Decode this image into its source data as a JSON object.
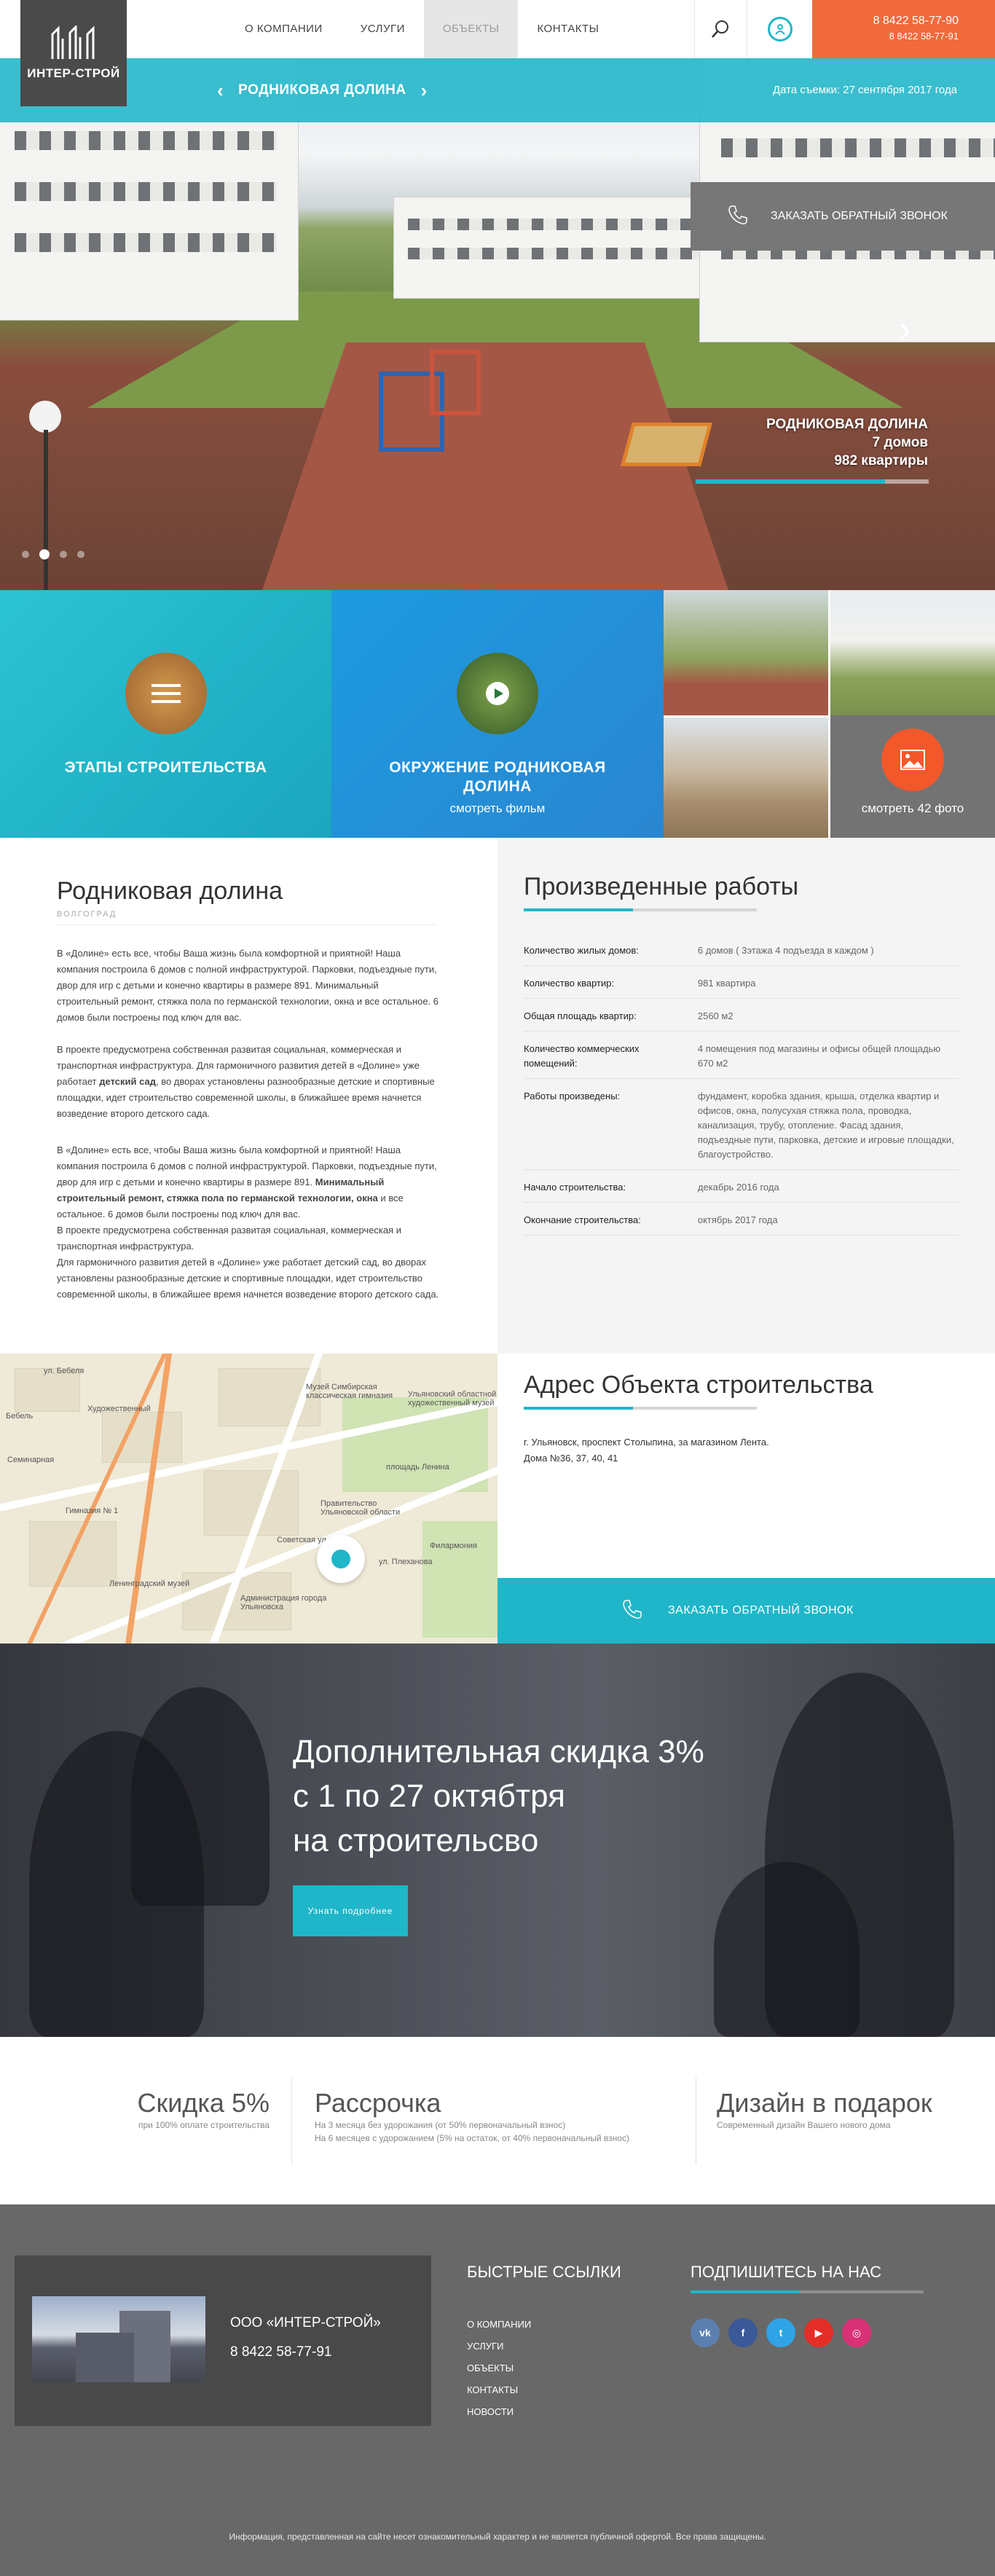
{
  "header": {
    "logo_text": "ИНТЕР-СТРОЙ",
    "nav": [
      "О КОМПАНИИ",
      "УСЛУГИ",
      "ОБЪЕКТЫ",
      "КОНТАКТЫ"
    ],
    "phone_1": "8 8422 58-77-90",
    "phone_2": "8 8422 58-77-91",
    "accent": "#1fb6c9",
    "phone_bg": "#f26a3b"
  },
  "hero": {
    "object_name": "РОДНИКОВАЯ ДОЛИНА",
    "shoot_date": "Дата съемки: 27 сентября 2017 года",
    "caption_title": "РОДНИКОВАЯ ДОЛИНА",
    "caption_houses": "7 домов",
    "caption_flats": "982 квартиры",
    "slide_count": 4,
    "active_slide": 2
  },
  "tiles": {
    "stages": "ЭТАПЫ СТРОИТЕЛЬСТВА",
    "env_line1": "ОКРУЖЕНИЕ РОДНИКОВАЯ",
    "env_line2": "ДОЛИНА",
    "env_sub": "смотреть фильм",
    "photos": "смотреть 42 фото"
  },
  "about": {
    "title": "Родниковая долина",
    "city": "ВОЛГОГРАД",
    "p1": "В «Долине» есть все, чтобы Ваша жизнь была комфортной и приятной! Наша компания построила 6 домов с полной инфраструктурой. Парковки, подъездные пути, двор для игр с детьми и конечно квартиры в размере 891. Минимальный строительный ремонт, стяжка пола по германской технологии, окна и все остальное. 6 домов были построены под ключ для вас.",
    "p2a": "В проекте предусмотрена собственная развитая социальная, коммерческая и транспортная инфраструктура. Для гармоничного развития детей в «Долине» уже работает ",
    "p2b": "детский сад",
    "p2c": ", во дворах установлены разнообразные детские и спортивные площадки, идет строительство современной школы, в ближайшее время начнется возведение второго детского сада.",
    "p3a": "В «Долине» есть все, чтобы Ваша жизнь была комфортной и приятной! Наша компания построила 6 домов с полной инфраструктурой. Парковки, подъездные пути, двор для игр с детьми и конечно квартиры в разме­ре 891. ",
    "p3b": "Минимальный строительный ремонт, стяжка пола по германской тех­нологии, окна",
    "p3c": " и все остальное. 6 домов были построены под ключ для вас.",
    "p3d": "В проекте предусмотрена собственная развитая социальная, коммерческая и транспортная инфраструктура.",
    "p3e": "Для гармоничного развития детей в «Долине» уже работает детский сад, во дворах установлены разнообразные детские и спортивные площадки, идет строительство современной школы, в ближайшее время начнется возведение второго детского сада."
  },
  "works": {
    "title": "Произведенные работы",
    "rows": [
      {
        "k": "Количество  жилых домов:",
        "v": "6 домов ( 3этажа 4 подъезда в каждом )"
      },
      {
        "k": "Количество квартир:",
        "v": "981 квартира"
      },
      {
        "k": "Общая площадь квартир:",
        "v": "2560 м2"
      },
      {
        "k": "Количество коммерческих помещений:",
        "v": "4 помещения под магазины и офисы общей площадью 670 м2"
      },
      {
        "k": "Работы произведены:",
        "v": "фундамент, коробка здания, крыша, отделка квартир и офисов, окна, полусухая стяжка пола, проводка, канализация, трубу, отопление. Фасад здания, подъездные пути, парковка, детские и игровые площадки, благоустройство."
      },
      {
        "k": "Начало строительства:",
        "v": "декабрь 2016 года"
      },
      {
        "k": "Окончание строительства:",
        "v": "октябрь 2017 года"
      }
    ]
  },
  "map": {
    "labels": [
      "ул. Бебеля",
      "Художественный",
      "Музей Симбирская классическая гимназия",
      "Ульяновский областной художественный музей",
      "площадь Ленина",
      "Правительство Ульяновской области",
      "Администрация города Ульяновска",
      "Гимназия № 1",
      "Филармония",
      "Ленинградский музей",
      "Советская ул.",
      "ул. Плеханова",
      "Семинарная",
      "Бебель"
    ]
  },
  "address": {
    "title": "Адрес Объекта строительства",
    "line1": "г. Ульяновск, проспект Столыпина, за магазином Лента.",
    "line2": "Дома №36, 37, 40, 41",
    "callback": "ЗАКАЗАТЬ ОБРАТНЫЙ ЗВОНОК"
  },
  "promo": {
    "line1": "Дополнительная скидка 3%",
    "line2": "с 1 по 27 октябтря",
    "line3": "на строительсво",
    "button": "Узнать подробнее"
  },
  "benefits": [
    {
      "title": "Скидка 5%",
      "sub1": "при 100% оплате строительства",
      "sub2": ""
    },
    {
      "title": "Рассрочка",
      "sub1": "На 3 месяца без удорожания (от 50% первоначальный взнос)",
      "sub2": "На 6 месяцев с удорожанием (5% на остаток, от 40% первоначальный взнос)"
    },
    {
      "title": "Дизайн в подарок",
      "sub1": "Современный дизайн Вашего нового дома",
      "sub2": ""
    }
  ],
  "footer": {
    "company": "ООО «ИНТЕР-СТРОЙ»",
    "phone": "8 8422 58-77-91",
    "links_title": "БЫСТРЫЕ ССЫЛКИ",
    "links": [
      "О КОМПАНИИ",
      "УСЛУГИ",
      "ОБЪЕКТЫ",
      "КОНТАКТЫ",
      "НОВОСТИ"
    ],
    "subscribe_title": "ПОДПИШИТЕСЬ НА НАС",
    "socials": [
      {
        "name": "vk-icon",
        "glyph": "vk",
        "color": "#5b7fb0"
      },
      {
        "name": "facebook-icon",
        "glyph": "f",
        "color": "#3b5998"
      },
      {
        "name": "twitter-icon",
        "glyph": "t",
        "color": "#2fa3e6"
      },
      {
        "name": "youtube-icon",
        "glyph": "▶",
        "color": "#e52d27"
      },
      {
        "name": "instagram-icon",
        "glyph": "◎",
        "color": "#d93175"
      }
    ],
    "callback": "ЗАКАЗАТЬ ОБРАТНЫЙ ЗВОНОК",
    "legal": "Информация, представленная на сайте несет ознакомительный характер и не является публичной офертой. Все права защищены."
  }
}
